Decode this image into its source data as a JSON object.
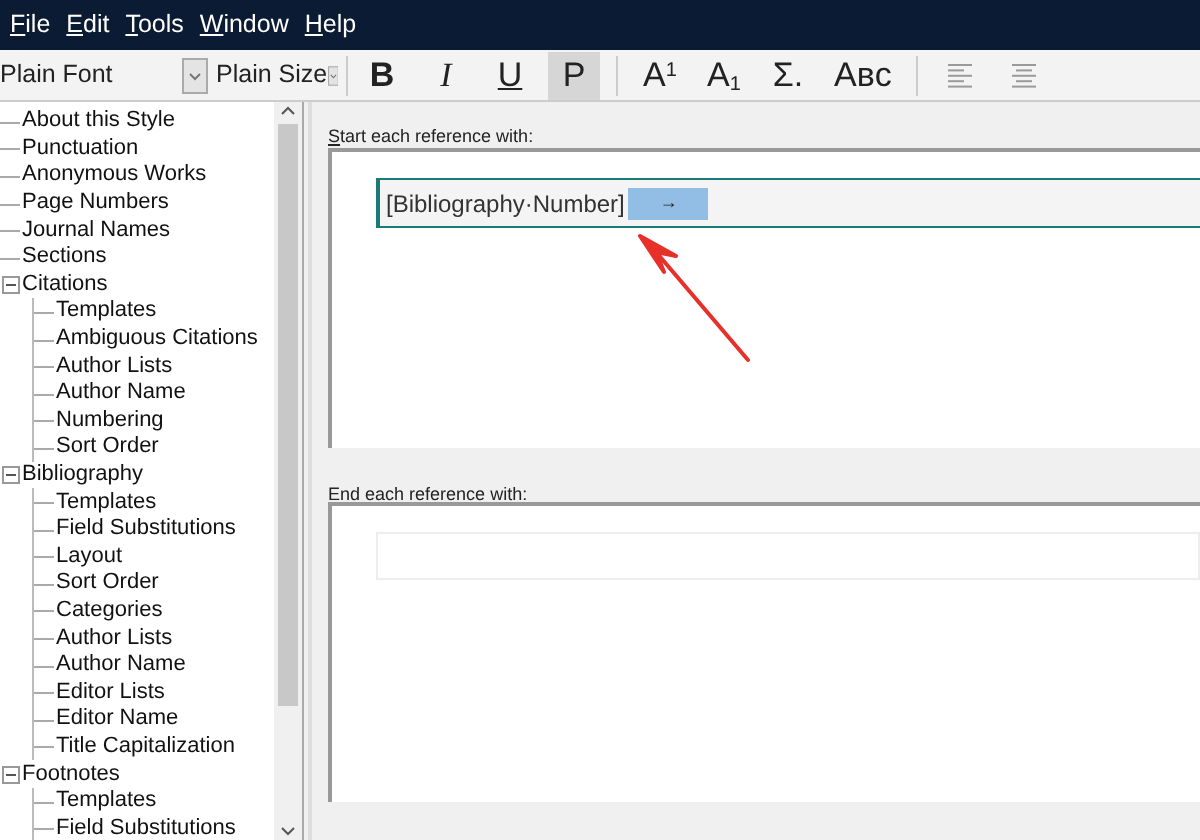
{
  "menu": [
    "File",
    "Edit",
    "Tools",
    "Window",
    "Help"
  ],
  "toolbar": {
    "font": "Plain Font",
    "size": "Plain Size",
    "buttons": [
      {
        "label": "B",
        "kind": "bold",
        "selected": false
      },
      {
        "label": "I",
        "kind": "italic",
        "selected": false
      },
      {
        "label": "U",
        "kind": "underline",
        "selected": false
      },
      {
        "label": "P",
        "kind": "plain",
        "selected": true
      },
      {
        "label": "A$^{1}$",
        "kind": "super",
        "selected": false
      },
      {
        "label": "A$_{1}$",
        "kind": "sub",
        "selected": false
      },
      {
        "label": "Σ.",
        "kind": "symbol",
        "selected": false
      },
      {
        "label": "Aʙᴄ",
        "kind": "smallcaps",
        "selected": false
      },
      {
        "kind": "align-left",
        "selected": false
      },
      {
        "kind": "align-center",
        "selected": false
      }
    ]
  },
  "tree": [
    {
      "label": "About this Style"
    },
    {
      "label": "Punctuation"
    },
    {
      "label": "Anonymous Works"
    },
    {
      "label": "Page Numbers"
    },
    {
      "label": "Journal Names"
    },
    {
      "label": "Sections"
    },
    {
      "label": "Citations",
      "expanded": true,
      "children": [
        {
          "label": "Templates"
        },
        {
          "label": "Ambiguous Citations"
        },
        {
          "label": "Author Lists"
        },
        {
          "label": "Author Name"
        },
        {
          "label": "Numbering"
        },
        {
          "label": "Sort Order"
        }
      ]
    },
    {
      "label": "Bibliography",
      "expanded": true,
      "children": [
        {
          "label": "Templates"
        },
        {
          "label": "Field Substitutions"
        },
        {
          "label": "Layout"
        },
        {
          "label": "Sort Order"
        },
        {
          "label": "Categories"
        },
        {
          "label": "Author Lists"
        },
        {
          "label": "Author Name"
        },
        {
          "label": "Editor Lists"
        },
        {
          "label": "Editor Name"
        },
        {
          "label": "Title Capitalization"
        }
      ]
    },
    {
      "label": "Footnotes",
      "expanded": true,
      "children": [
        {
          "label": "Templates"
        },
        {
          "label": "Field Substitutions"
        }
      ]
    }
  ],
  "start": {
    "label": "Start each reference with:",
    "value": "[Bibliography·Number]",
    "selected_text": "→"
  },
  "end": {
    "label": "End each reference with:"
  }
}
